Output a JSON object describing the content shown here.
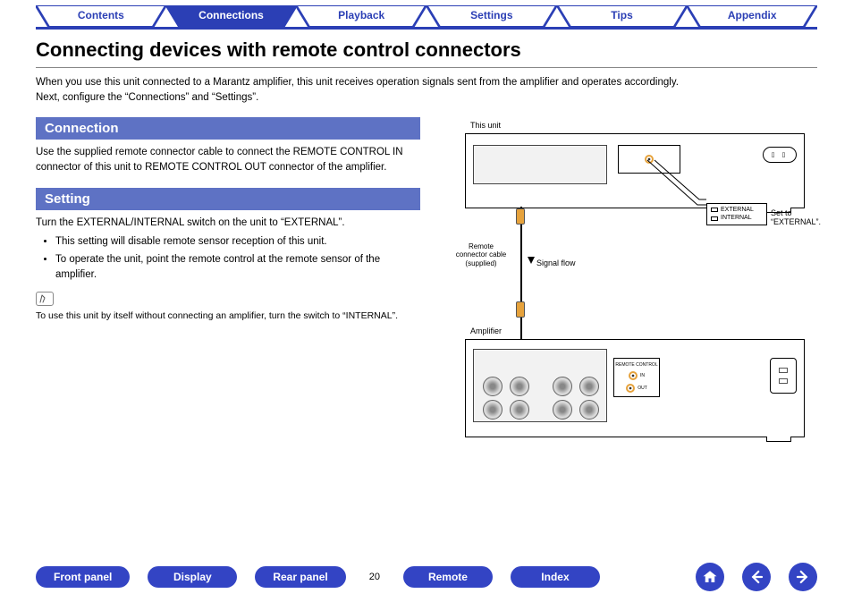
{
  "tabs": {
    "contents": "Contents",
    "connections": "Connections",
    "playback": "Playback",
    "settings": "Settings",
    "tips": "Tips",
    "appendix": "Appendix"
  },
  "page_title": "Connecting devices with remote control connectors",
  "intro_line1": "When you use this unit connected to a Marantz amplifier, this unit receives operation signals sent from the amplifier and operates accordingly.",
  "intro_line2": "Next, configure the “Connections” and “Settings”.",
  "connection": {
    "title": "Connection",
    "text": "Use the supplied remote connector cable to connect the REMOTE CONTROL IN connector of this unit to REMOTE CONTROL OUT connector of the amplifier."
  },
  "setting": {
    "title": "Setting",
    "text": "Turn the EXTERNAL/INTERNAL switch on the unit to “EXTERNAL”.",
    "bullets": [
      "This setting will disable remote sensor reception of this unit.",
      "To operate the unit, point the remote control at the remote sensor of the amplifier."
    ],
    "note": "To use this unit by itself without connecting an amplifier, turn the switch to “INTERNAL”."
  },
  "diagram": {
    "this_unit": "This unit",
    "amplifier": "Amplifier",
    "switch_external": "EXTERNAL",
    "switch_internal": "INTERNAL",
    "set_to": "Set to “EXTERNAL”.",
    "remote_cable": "Remote connector cable (supplied)",
    "signal_flow": "Signal flow",
    "remote_control_label": "REMOTE CONTROL",
    "in_label": "IN",
    "out_label": "OUT"
  },
  "bottom": {
    "front_panel": "Front panel",
    "display": "Display",
    "rear_panel": "Rear panel",
    "remote": "Remote",
    "index": "Index",
    "page": "20"
  }
}
